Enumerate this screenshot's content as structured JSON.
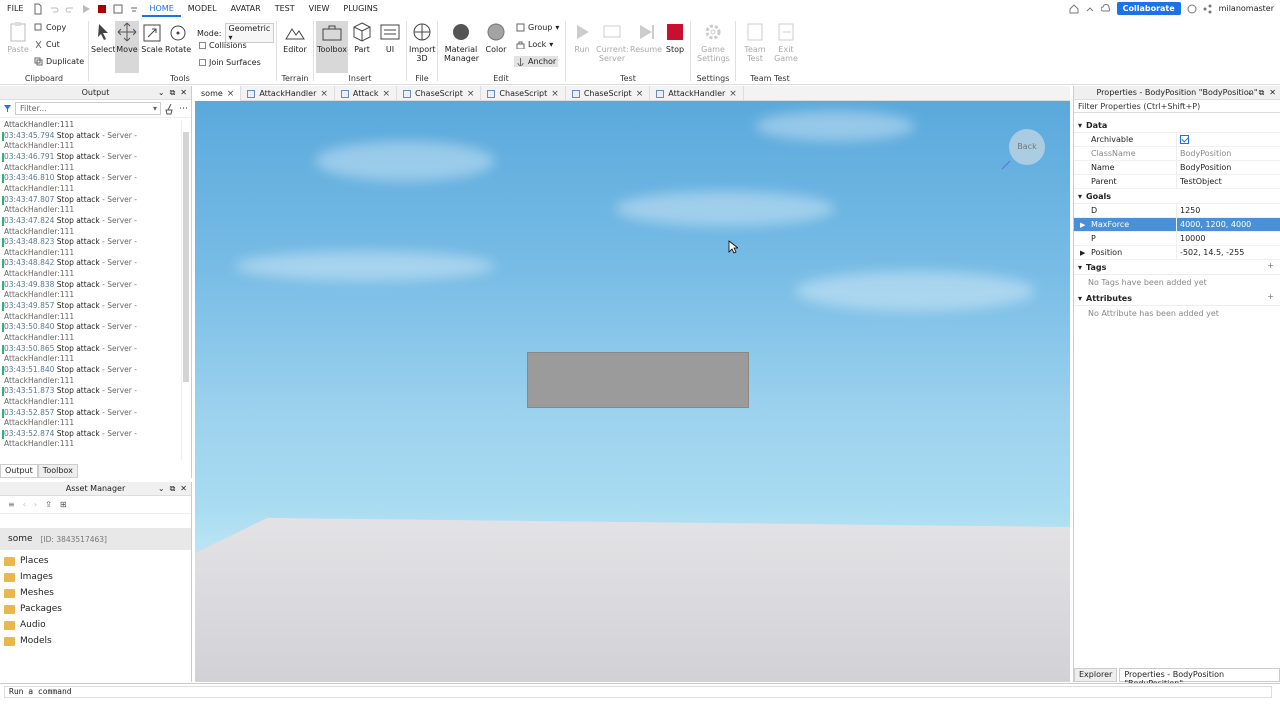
{
  "menubar": {
    "items": [
      "FILE",
      "HOME",
      "MODEL",
      "AVATAR",
      "TEST",
      "VIEW",
      "PLUGINS"
    ],
    "active": "HOME",
    "collaborate_label": "Collaborate",
    "username": "milanomaster"
  },
  "ribbon": {
    "clipboard": {
      "paste": "Paste",
      "copy": "Copy",
      "cut": "Cut",
      "duplicate": "Duplicate",
      "label": "Clipboard"
    },
    "tools": {
      "select": "Select",
      "move": "Move",
      "scale": "Scale",
      "rotate": "Rotate",
      "mode_label": "Mode:",
      "mode_value": "Geometric",
      "collisions": "Collisions",
      "join_surfaces": "Join Surfaces",
      "label": "Tools"
    },
    "terrain": {
      "editor": "Editor",
      "label": "Terrain"
    },
    "insert": {
      "toolbox": "Toolbox",
      "part": "Part",
      "ui": "UI",
      "label": "Insert"
    },
    "file": {
      "import": "Import 3D",
      "label": "File"
    },
    "edit": {
      "material": "Material Manager",
      "color": "Color",
      "group": "Group",
      "lock": "Lock",
      "anchor": "Anchor",
      "label": "Edit"
    },
    "test": {
      "run": "Run",
      "current": "Current: Server",
      "resume": "Resume",
      "stop": "Stop",
      "label": "Test"
    },
    "settings": {
      "game_settings": "Game Settings",
      "label": "Settings"
    },
    "team_test": {
      "team_test": "Team Test",
      "exit_game": "Exit Game",
      "label": "Team Test"
    }
  },
  "output": {
    "title": "Output",
    "filter_placeholder": "Filter...",
    "first_line": "AttackHandler:111",
    "entries": [
      {
        "ts": "03:43:45.794",
        "msg": "Stop attack",
        "src": "- Server -",
        "loc": "AttackHandler:111"
      },
      {
        "ts": "03:43:46.791",
        "msg": "Stop attack",
        "src": "- Server -",
        "loc": "AttackHandler:111"
      },
      {
        "ts": "03:43:46.810",
        "msg": "Stop attack",
        "src": "- Server -",
        "loc": "AttackHandler:111"
      },
      {
        "ts": "03:43:47.807",
        "msg": "Stop attack",
        "src": "- Server -",
        "loc": "AttackHandler:111"
      },
      {
        "ts": "03:43:47.824",
        "msg": "Stop attack",
        "src": "- Server -",
        "loc": "AttackHandler:111"
      },
      {
        "ts": "03:43:48.823",
        "msg": "Stop attack",
        "src": "- Server -",
        "loc": "AttackHandler:111"
      },
      {
        "ts": "03:43:48.842",
        "msg": "Stop attack",
        "src": "- Server -",
        "loc": "AttackHandler:111"
      },
      {
        "ts": "03:43:49.838",
        "msg": "Stop attack",
        "src": "- Server -",
        "loc": "AttackHandler:111"
      },
      {
        "ts": "03:43:49.857",
        "msg": "Stop attack",
        "src": "- Server -",
        "loc": "AttackHandler:111"
      },
      {
        "ts": "03:43:50.840",
        "msg": "Stop attack",
        "src": "- Server -",
        "loc": "AttackHandler:111"
      },
      {
        "ts": "03:43:50.865",
        "msg": "Stop attack",
        "src": "- Server -",
        "loc": "AttackHandler:111"
      },
      {
        "ts": "03:43:51.840",
        "msg": "Stop attack",
        "src": "- Server -",
        "loc": "AttackHandler:111"
      },
      {
        "ts": "03:43:51.873",
        "msg": "Stop attack",
        "src": "- Server -",
        "loc": "AttackHandler:111"
      },
      {
        "ts": "03:43:52.857",
        "msg": "Stop attack",
        "src": "- Server -",
        "loc": "AttackHandler:111"
      },
      {
        "ts": "03:43:52.874",
        "msg": "Stop attack",
        "src": "- Server -",
        "loc": "AttackHandler:111"
      }
    ],
    "tabs": [
      "Output",
      "Toolbox"
    ]
  },
  "asset_manager": {
    "title": "Asset Manager",
    "place_name": "some",
    "place_id": "[ID: 3843517463]",
    "items": [
      "Places",
      "Images",
      "Meshes",
      "Packages",
      "Audio",
      "Models"
    ]
  },
  "editor_tabs": [
    {
      "label": "some",
      "active": true,
      "script": false
    },
    {
      "label": "AttackHandler",
      "active": false,
      "script": true
    },
    {
      "label": "Attack",
      "active": false,
      "script": true
    },
    {
      "label": "ChaseScript",
      "active": false,
      "script": true
    },
    {
      "label": "ChaseScript",
      "active": false,
      "script": true
    },
    {
      "label": "ChaseScript",
      "active": false,
      "script": true
    },
    {
      "label": "AttackHandler",
      "active": false,
      "script": true
    }
  ],
  "viewport": {
    "back_label": "Back"
  },
  "properties": {
    "title": "Properties - BodyPosition \"BodyPosition\"",
    "filter_placeholder": "Filter Properties (Ctrl+Shift+P)",
    "sections": {
      "data": {
        "title": "Data",
        "rows": [
          {
            "name": "Archivable",
            "value": "",
            "checkbox": true
          },
          {
            "name": "ClassName",
            "value": "BodyPosition",
            "grey": true
          },
          {
            "name": "Name",
            "value": "BodyPosition"
          },
          {
            "name": "Parent",
            "value": "TestObject"
          }
        ]
      },
      "goals": {
        "title": "Goals",
        "rows": [
          {
            "name": "D",
            "value": "1250"
          },
          {
            "name": "MaxForce",
            "value": "4000, 1200, 4000",
            "selected": true,
            "expandable": true
          },
          {
            "name": "P",
            "value": "10000"
          },
          {
            "name": "Position",
            "value": "-502, 14.5, -255",
            "expandable": true
          }
        ]
      },
      "tags": {
        "title": "Tags",
        "empty": "No Tags have been added yet"
      },
      "attributes": {
        "title": "Attributes",
        "empty": "No Attribute has been added yet"
      }
    },
    "bottom_tabs": [
      "Explorer",
      "Properties - BodyPosition \"BodyPosition\""
    ]
  },
  "command_bar": {
    "placeholder": "Run a command"
  },
  "colors": {
    "accent": "#1a73e8",
    "selection": "#4a90d9",
    "log_bar": "#2bb673",
    "stop_red": "#c8102e"
  }
}
